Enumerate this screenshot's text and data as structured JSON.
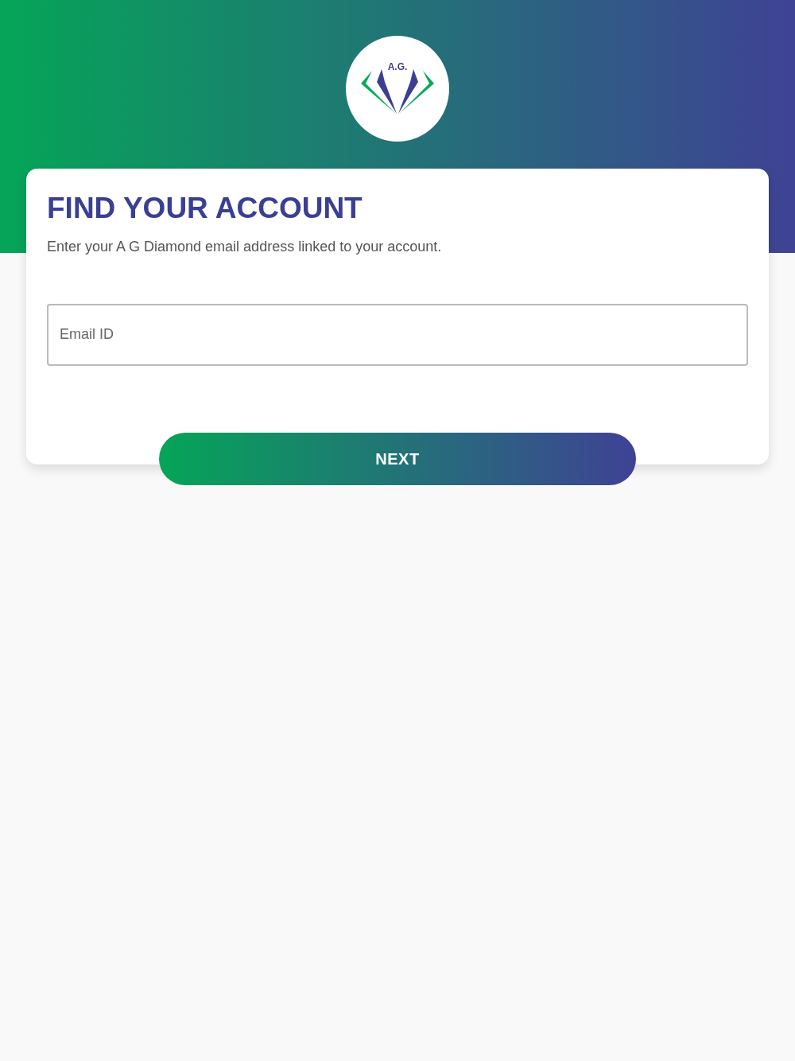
{
  "logo": {
    "text": "A.G."
  },
  "card": {
    "title": "FIND YOUR ACCOUNT",
    "subtitle": "Enter your A G Diamond email address linked to your account."
  },
  "email_field": {
    "placeholder": "Email ID"
  },
  "next_button": {
    "label": "NEXT"
  }
}
